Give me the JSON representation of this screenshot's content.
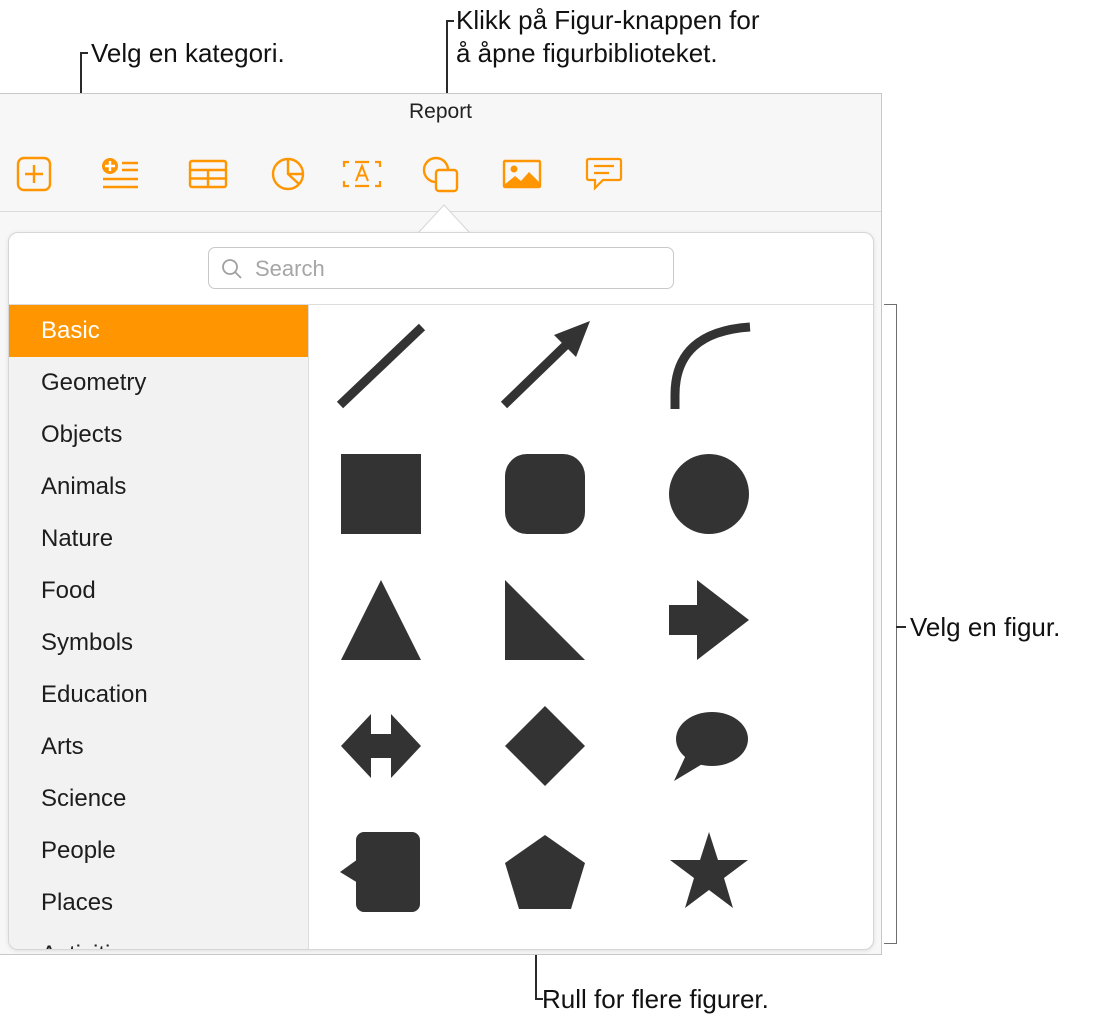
{
  "callouts": {
    "category": "Velg en kategori.",
    "shape_button_line1": "Klikk på Figur-knappen for",
    "shape_button_line2": "å åpne figurbiblioteket.",
    "choose_shape": "Velg en figur.",
    "scroll": "Rull for flere figurer."
  },
  "window": {
    "title": "Report"
  },
  "toolbar": {
    "icons": [
      "add-icon",
      "insert-list-icon",
      "table-icon",
      "chart-icon",
      "text-box-icon",
      "shape-icon",
      "media-icon",
      "comment-icon"
    ],
    "accent_color": "#ff9500"
  },
  "search": {
    "placeholder": "Search",
    "value": ""
  },
  "categories": {
    "items": [
      "Basic",
      "Geometry",
      "Objects",
      "Animals",
      "Nature",
      "Food",
      "Symbols",
      "Education",
      "Arts",
      "Science",
      "People",
      "Places",
      "Activities"
    ],
    "selected": "Basic"
  },
  "shapes": [
    "line",
    "arrow-line",
    "curve",
    "square",
    "rounded-square",
    "circle",
    "triangle",
    "right-triangle",
    "arrow",
    "double-arrow",
    "diamond",
    "speech-bubble",
    "callout-rectangle",
    "pentagon",
    "star"
  ],
  "colors": {
    "selected_bg": "#ff9500",
    "shape_fill": "#333333"
  }
}
